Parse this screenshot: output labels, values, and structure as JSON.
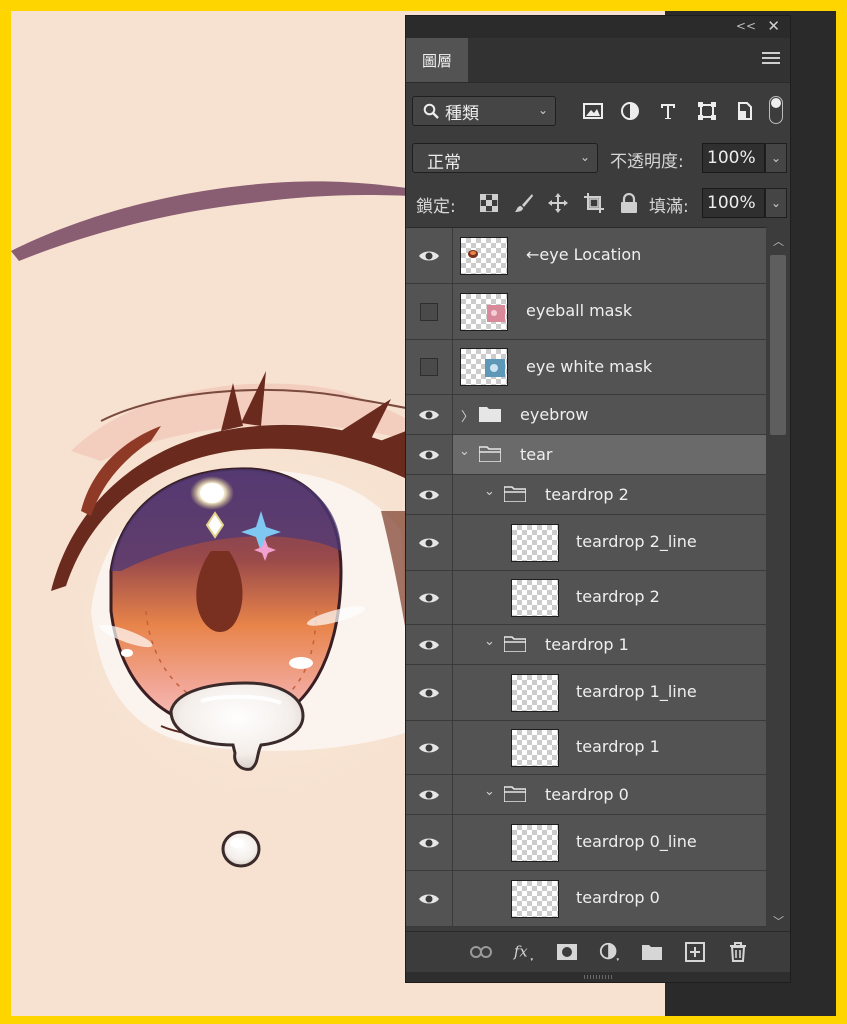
{
  "panel": {
    "collapse_glyph": "<<",
    "close_glyph": "✕",
    "tab_label": "圖層",
    "filter": {
      "kind_label": "種類"
    },
    "blend": {
      "mode": "正常",
      "opacity_label": "不透明度:",
      "opacity_value": "100%"
    },
    "lock": {
      "label": "鎖定:",
      "fill_label": "填滿:",
      "fill_value": "100%"
    },
    "layers": [
      {
        "name": "←eye Location",
        "visible": true,
        "type": "layer",
        "thumb": "eye-location"
      },
      {
        "name": "eyeball mask",
        "visible": false,
        "type": "layer",
        "thumb": "pink-mask"
      },
      {
        "name": "eye white mask",
        "visible": false,
        "type": "layer",
        "thumb": "blue-mask"
      },
      {
        "name": "eyebrow",
        "visible": true,
        "type": "group",
        "expanded": false
      },
      {
        "name": "tear",
        "visible": true,
        "type": "group",
        "expanded": true,
        "selected": true
      },
      {
        "name": "teardrop 2",
        "visible": true,
        "type": "group",
        "expanded": true
      },
      {
        "name": "teardrop 2_line",
        "visible": true,
        "type": "layer"
      },
      {
        "name": "teardrop 2",
        "visible": true,
        "type": "layer"
      },
      {
        "name": "teardrop 1",
        "visible": true,
        "type": "group",
        "expanded": true
      },
      {
        "name": "teardrop 1_line",
        "visible": true,
        "type": "layer"
      },
      {
        "name": "teardrop 1",
        "visible": true,
        "type": "layer"
      },
      {
        "name": "teardrop 0",
        "visible": true,
        "type": "group",
        "expanded": true
      },
      {
        "name": "teardrop 0_line",
        "visible": true,
        "type": "layer"
      },
      {
        "name": "teardrop 0",
        "visible": true,
        "type": "layer"
      }
    ]
  },
  "colors": {
    "frame": "#FFD500",
    "canvas": "#F7E2D1",
    "panel_bg": "#3C3C3C",
    "row_bg": "#535353",
    "row_selected": "#6A6A6A",
    "iris_orange": "#E8844A",
    "eyelash_brown": "#6B2A1E"
  },
  "icons": {
    "filter": [
      "image-filter-icon",
      "adjustment-filter-icon",
      "type-filter-icon",
      "shape-filter-icon",
      "smart-object-filter-icon"
    ],
    "lock": [
      "lock-transparent-pixels-icon",
      "lock-image-pixels-icon",
      "lock-position-icon",
      "lock-artboard-icon",
      "lock-all-icon"
    ],
    "bottom": [
      "link-layers-icon",
      "layer-style-icon",
      "add-mask-icon",
      "new-adjustment-icon",
      "new-group-icon",
      "new-layer-icon",
      "delete-layer-icon"
    ]
  }
}
